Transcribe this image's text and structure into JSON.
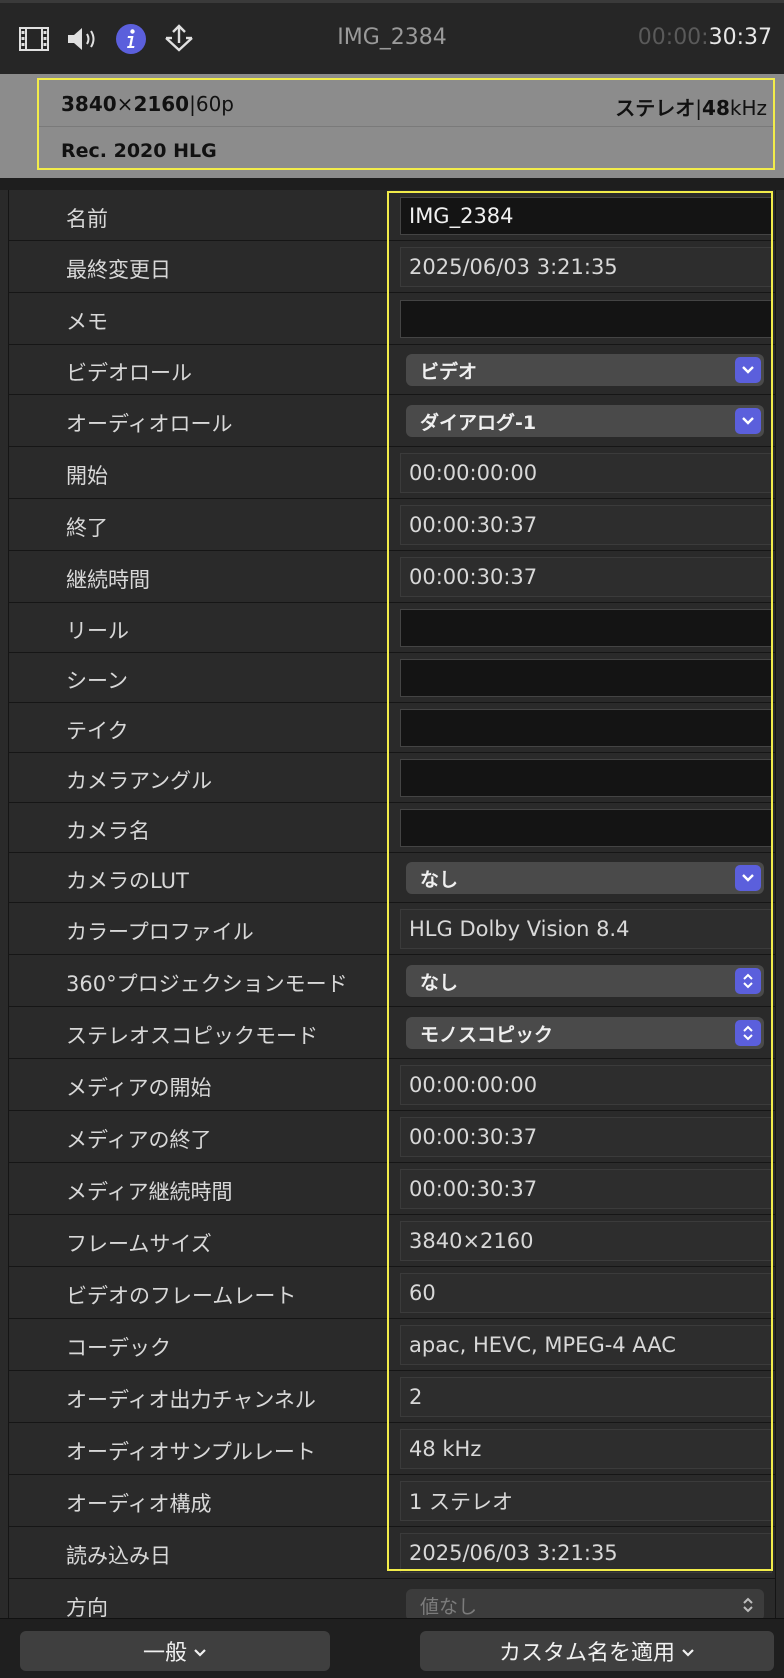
{
  "toolbar": {
    "icons": [
      "film-icon",
      "speaker-icon",
      "info-icon",
      "share-icon"
    ],
    "clip_name": "IMG_2384",
    "timecode_dim": "00:00:",
    "timecode_bright": "30:37"
  },
  "summary": {
    "resolution_w": "3840",
    "resolution_x": "×",
    "resolution_h": "2160",
    "frame_rate": "|60p",
    "audio_label": "ステレオ",
    "audio_sep": "|",
    "audio_rate": "48",
    "audio_unit": "kHz",
    "color_space": "Rec. 2020 HLG"
  },
  "rows": [
    {
      "label": "名前",
      "type": "editable",
      "value": "IMG_2384"
    },
    {
      "label": "最終変更日",
      "type": "readonly",
      "value": "2025/06/03 3:21:35"
    },
    {
      "label": "メモ",
      "type": "editable",
      "value": ""
    },
    {
      "label": "ビデオロール",
      "type": "popup",
      "value": "ビデオ",
      "chev": "down"
    },
    {
      "label": "オーディオロール",
      "type": "popup",
      "value": "ダイアログ-1",
      "chev": "down"
    },
    {
      "label": "開始",
      "type": "readonly",
      "value": "00:00:00:00"
    },
    {
      "label": "終了",
      "type": "readonly",
      "value": "00:00:30:37"
    },
    {
      "label": "継続時間",
      "type": "readonly",
      "value": "00:00:30:37"
    },
    {
      "label": "リール",
      "type": "editable",
      "value": ""
    },
    {
      "label": "シーン",
      "type": "editable",
      "value": ""
    },
    {
      "label": "テイク",
      "type": "editable",
      "value": ""
    },
    {
      "label": "カメラアングル",
      "type": "editable",
      "value": ""
    },
    {
      "label": "カメラ名",
      "type": "editable",
      "value": ""
    },
    {
      "label": "カメラのLUT",
      "type": "popup",
      "value": "なし",
      "chev": "down"
    },
    {
      "label": "カラープロファイル",
      "type": "readonly",
      "value": "HLG Dolby Vision 8.4"
    },
    {
      "label": "360°プロジェクションモード",
      "type": "popup",
      "value": "なし",
      "chev": "updown"
    },
    {
      "label": "ステレオスコピックモード",
      "type": "popup",
      "value": "モノスコピック",
      "chev": "updown"
    },
    {
      "label": "メディアの開始",
      "type": "readonly",
      "value": "00:00:00:00"
    },
    {
      "label": "メディアの終了",
      "type": "readonly",
      "value": "00:00:30:37"
    },
    {
      "label": "メディア継続時間",
      "type": "readonly",
      "value": "00:00:30:37"
    },
    {
      "label": "フレームサイズ",
      "type": "readonly",
      "value": "3840×2160"
    },
    {
      "label": "ビデオのフレームレート",
      "type": "readonly",
      "value": "60"
    },
    {
      "label": "コーデック",
      "type": "readonly",
      "value": "apac, HEVC, MPEG-4 AAC"
    },
    {
      "label": "オーディオ出力チャンネル",
      "type": "readonly",
      "value": "2"
    },
    {
      "label": "オーディオサンプルレート",
      "type": "readonly",
      "value": "48 kHz"
    },
    {
      "label": "オーディオ構成",
      "type": "readonly",
      "value": "1 ステレオ"
    },
    {
      "label": "読み込み日",
      "type": "readonly",
      "value": "2025/06/03 3:21:35"
    },
    {
      "label": "方向",
      "type": "popup-disabled",
      "value": "値なし",
      "chev": "updown"
    }
  ],
  "footer": {
    "general_label": "一般",
    "apply_custom_name_label": "カスタム名を適用"
  },
  "colors": {
    "accent": "#5b5fdc",
    "highlight": "#f2ec4a"
  }
}
